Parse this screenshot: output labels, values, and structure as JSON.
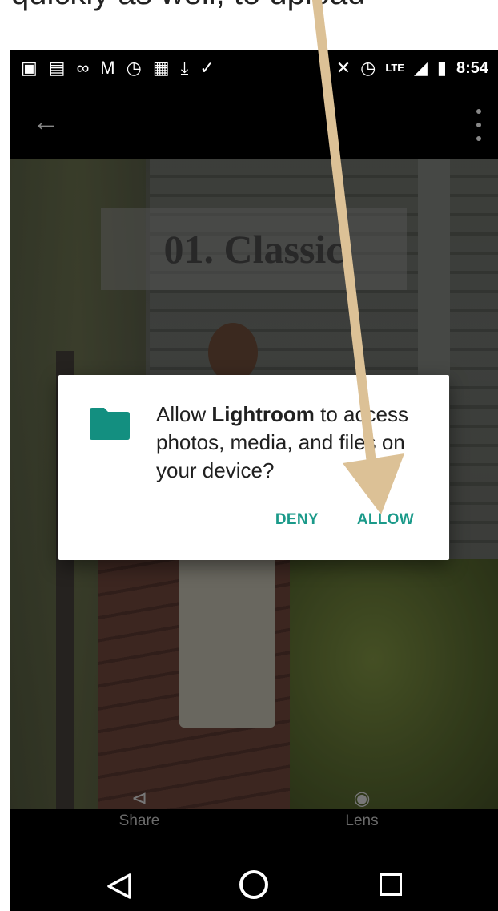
{
  "caption": {
    "text": "quickly as well, to upload"
  },
  "status_bar": {
    "left_icons": [
      "message-icon",
      "notes-icon",
      "voicemail-icon",
      "gmail-icon",
      "alarm-icon",
      "photo-icon",
      "download-icon",
      "check-icon"
    ],
    "right_icons": [
      "bluetooth-icon",
      "alarm-icon",
      "signal-icon",
      "battery-icon"
    ],
    "network": "LTE",
    "time": "8:54"
  },
  "app_bar": {
    "back_icon": "arrow-left-icon",
    "menu_icon": "more-vert-icon"
  },
  "photo": {
    "banner_text": "01. Classic"
  },
  "dialog": {
    "message_prefix": "Allow ",
    "app_name": "Lightroom",
    "message_suffix": " to access photos, media, and files on your device?",
    "deny_label": "DENY",
    "allow_label": "ALLOW",
    "icon_color": "#138f80"
  },
  "bottom_actions": {
    "share_label": "Share",
    "lens_label": "Lens"
  },
  "nav_bar": {
    "icons": [
      "nav-back-icon",
      "nav-home-icon",
      "nav-recents-icon"
    ]
  },
  "annotation": {
    "color": "#dcc196"
  }
}
